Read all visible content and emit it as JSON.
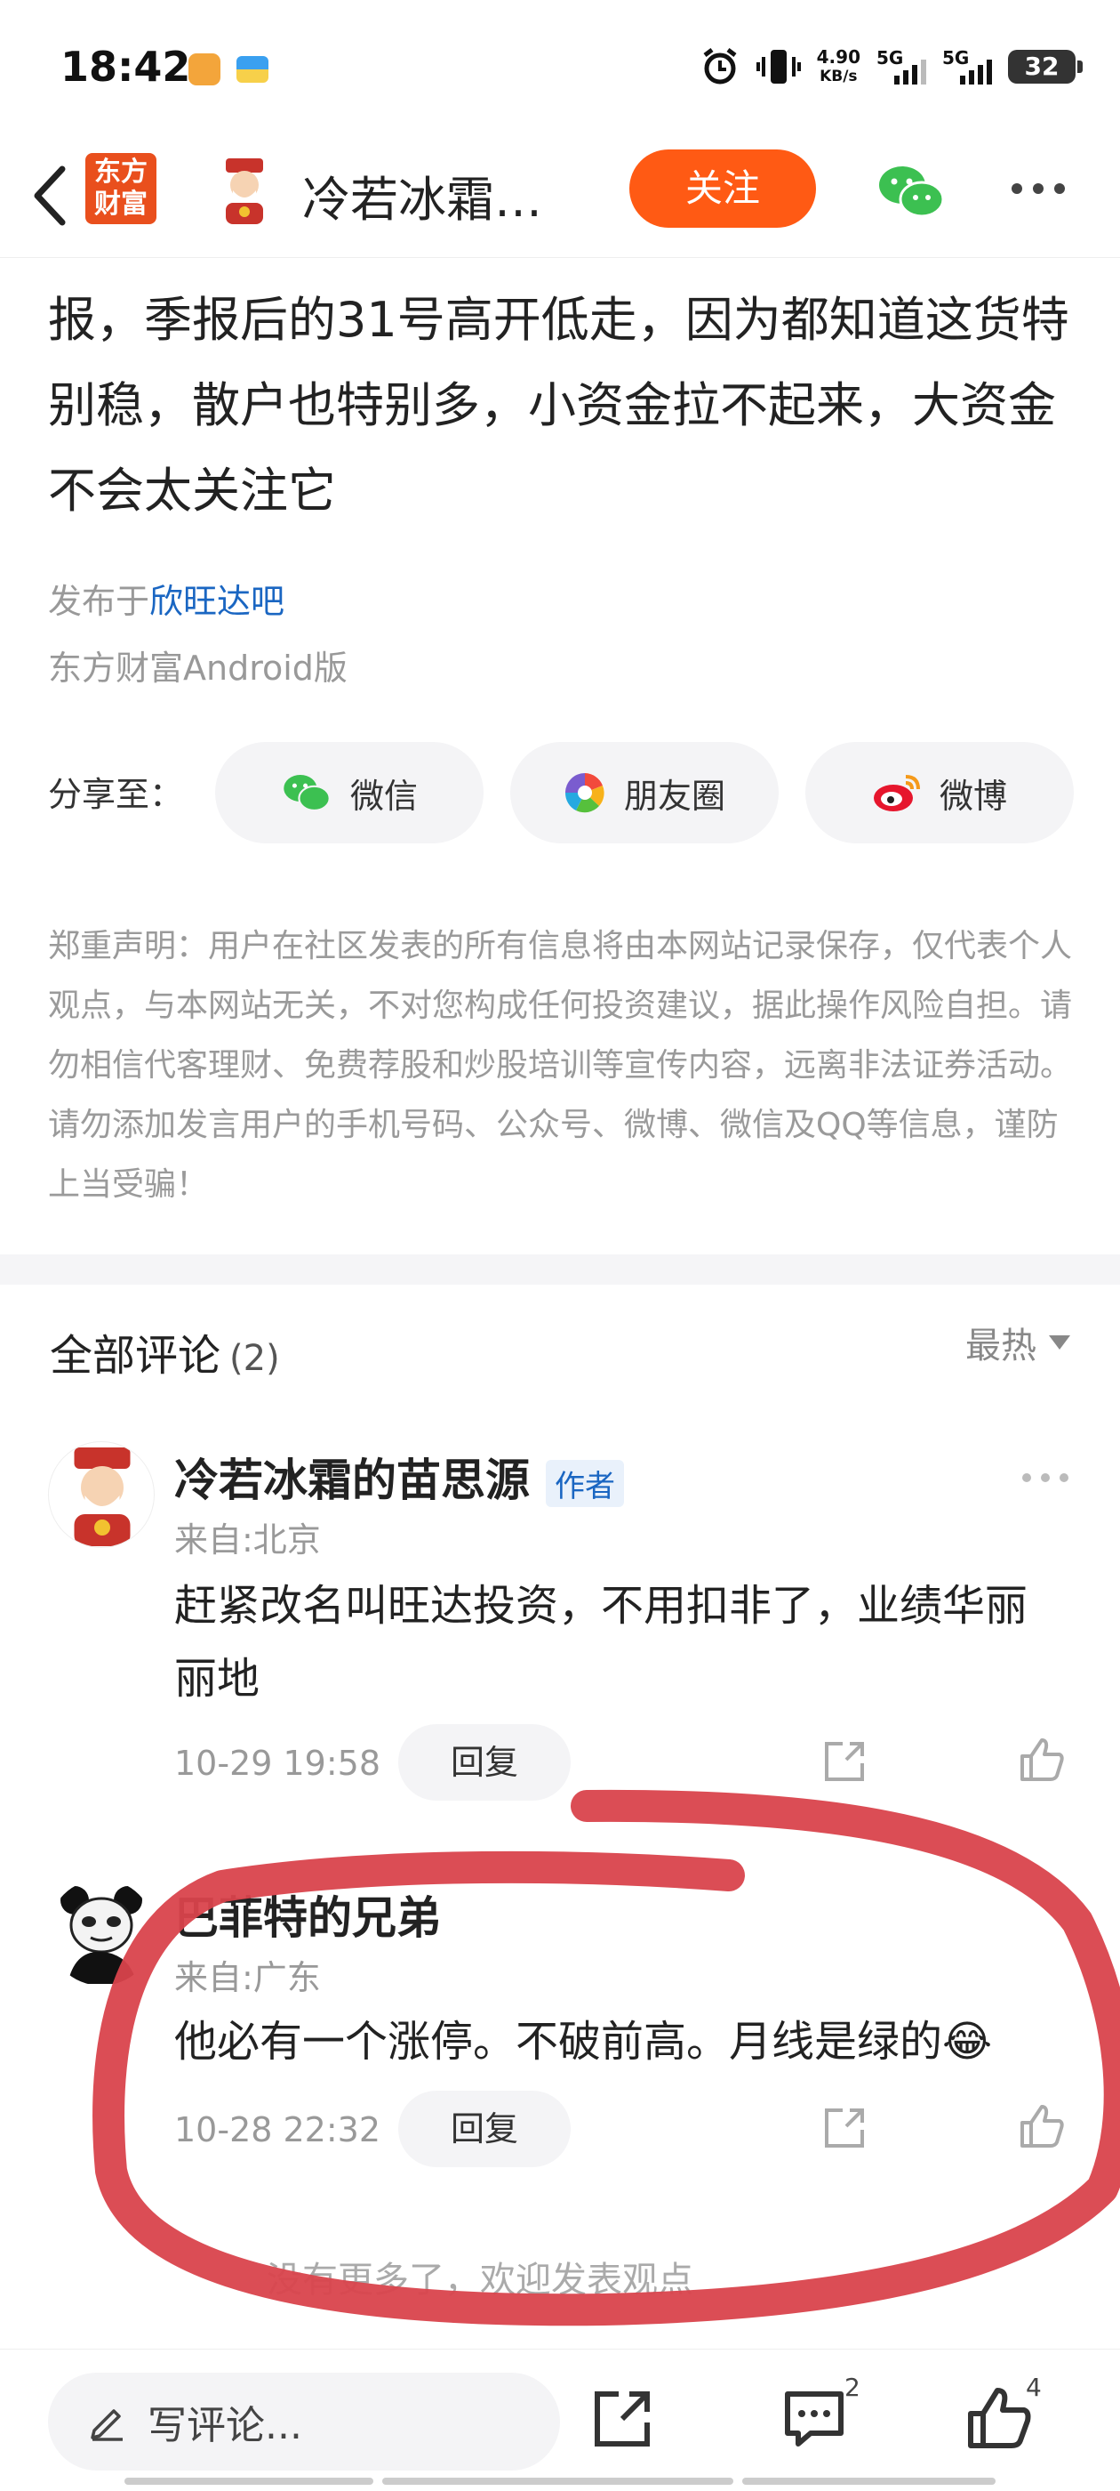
{
  "status_bar": {
    "time": "18:42",
    "speed_value": "4.90",
    "speed_unit": "KB/s",
    "net1": "5G",
    "net2": "5G",
    "battery": "32"
  },
  "header": {
    "app_logo_line1": "东方",
    "app_logo_line2": "财富",
    "title": "冷若冰霜…",
    "follow_label": "关注"
  },
  "article": {
    "text": "报，季报后的31号高开低走，因为都知道这货特别稳，散户也特别多，小资金拉不起来，大资金不会太关注它",
    "published_prefix": "发布于",
    "published_bar": "欣旺达吧",
    "client": "东方财富Android版"
  },
  "share": {
    "label": "分享至：",
    "buttons": [
      {
        "label": "微信"
      },
      {
        "label": "朋友圈"
      },
      {
        "label": "微博"
      }
    ]
  },
  "disclaimer": "郑重声明：用户在社区发表的所有信息将由本网站记录保存，仅代表个人观点，与本网站无关，不对您构成任何投资建议，据此操作风险自担。请勿相信代客理财、免费荐股和炒股培训等宣传内容，远离非法证券活动。请勿添加发言用户的手机号码、公众号、微博、微信及QQ等信息，谨防上当受骗！",
  "comments": {
    "title": "全部评论",
    "count": "(2)",
    "sort_label": "最热",
    "items": [
      {
        "name": "冷若冰霜的苗思源",
        "badge": "作者",
        "location": "来自:北京",
        "text": "赶紧改名叫旺达投资，不用扣非了，业绩华丽丽地",
        "time": "10-29 19:58",
        "reply_label": "回复"
      },
      {
        "name": "巴菲特的兄弟",
        "location": "来自:广东",
        "text": "他必有一个涨停。不破前高。月线是绿的😂",
        "time": "10-28 22:32",
        "reply_label": "回复"
      }
    ],
    "bottom_hint": "没有更多了，欢迎发表观点"
  },
  "bottom_bar": {
    "write_placeholder": "写评论...",
    "comment_count": "2",
    "like_count": "4"
  },
  "colors": {
    "accent_orange": "#ff5a14",
    "link_blue": "#1a66c2",
    "annotation_red": "#d9434c"
  }
}
